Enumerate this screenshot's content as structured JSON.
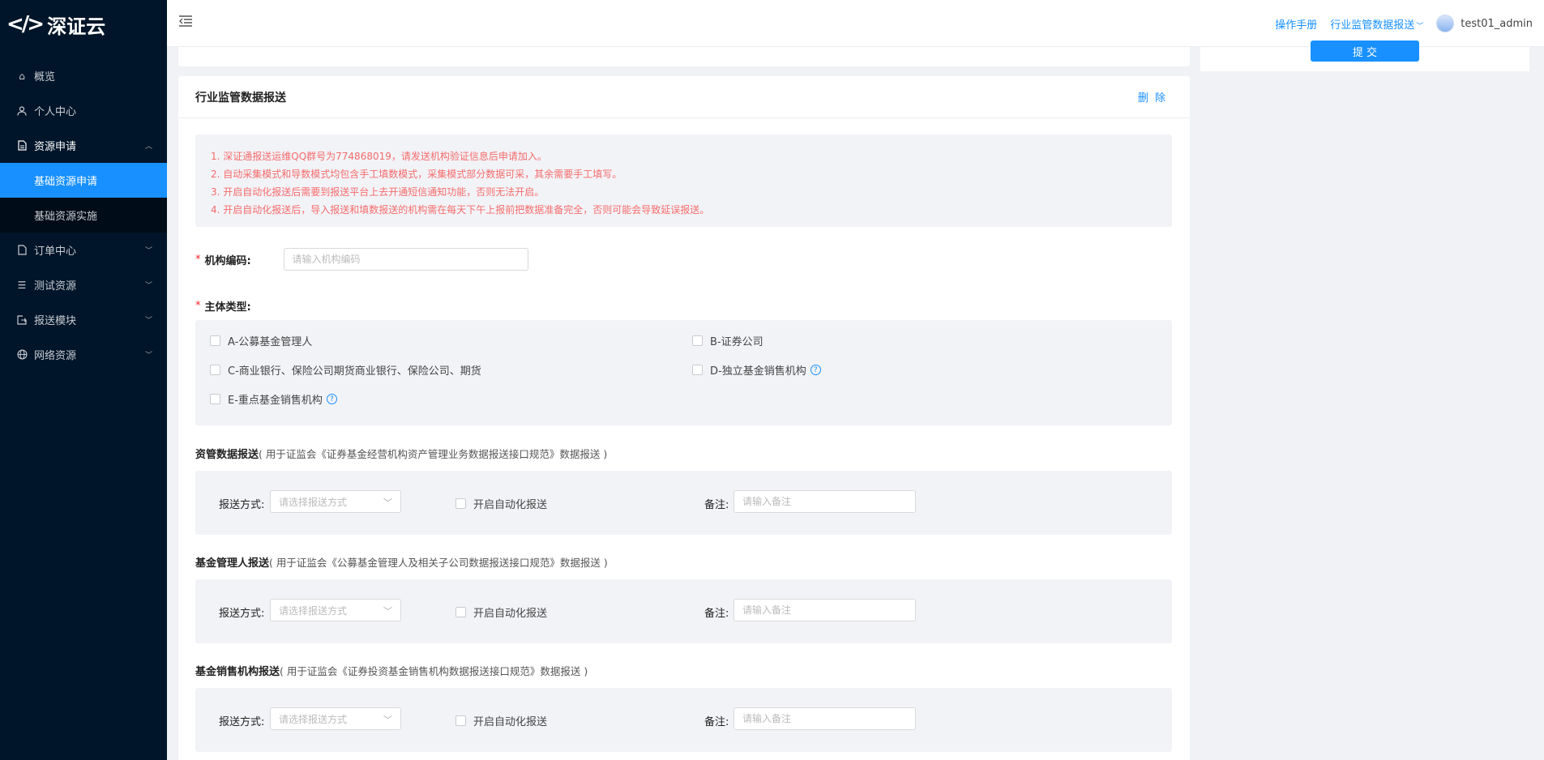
{
  "brand": {
    "name": "深证云",
    "mark": "</>"
  },
  "sidebar": {
    "items": [
      {
        "label": "概览"
      },
      {
        "label": "个人中心"
      },
      {
        "label": "资源申请"
      },
      {
        "label": "订单中心"
      },
      {
        "label": "测试资源"
      },
      {
        "label": "报送模块"
      },
      {
        "label": "网络资源"
      }
    ],
    "subitems": [
      {
        "label": "基础资源申请"
      },
      {
        "label": "基础资源实施"
      }
    ]
  },
  "header": {
    "manual": "操作手册",
    "report_menu": "行业监管数据报送",
    "user": "test01_admin"
  },
  "submit_label": "提 交",
  "card": {
    "title": "行业监管数据报送",
    "delete_label": "删 除",
    "notices": [
      "1. 深证通报送运维QQ群号为774868019，请发送机构验证信息后申请加入。",
      "2. 自动采集模式和导数模式均包含手工填数模式，采集模式部分数据可采，其余需要手工填写。",
      "3. 开启自动化报送后需要到报送平台上去开通短信通知功能，否则无法开启。",
      "4. 开启自动化报送后，导入报送和填数报送的机构需在每天下午上报前把数据准备完全，否则可能会导致延误报送。"
    ],
    "org_code": {
      "label": "机构编码:",
      "placeholder": "请输入机构编码"
    },
    "entity_type": {
      "label": "主体类型:",
      "options": [
        "A-公募基金管理人",
        "B-证券公司",
        "C-商业银行、保险公司期货商业银行、保险公司、期货",
        "D-独立基金销售机构",
        "E-重点基金销售机构"
      ]
    },
    "sections": [
      {
        "title": "资管数据报送",
        "desc": "( 用于证监会《证券基金经营机构资产管理业务数据报送接口规范》数据报送 )"
      },
      {
        "title": "基金管理人报送",
        "desc": "( 用于证监会《公募基金管理人及相关子公司数据报送接口规范》数据报送 )"
      },
      {
        "title": "基金销售机构报送",
        "desc": "( 用于证监会《证券投资基金销售机构数据报送接口规范》数据报送 )"
      }
    ],
    "form": {
      "method_label": "报送方式:",
      "method_placeholder": "请选择报送方式",
      "auto_label": "开启自动化报送",
      "remark_label": "备注:",
      "remark_placeholder": "请输入备注"
    }
  },
  "colors": {
    "sidebar_bg": "#001529",
    "active": "#1890ff",
    "danger": "#f56c6c"
  }
}
